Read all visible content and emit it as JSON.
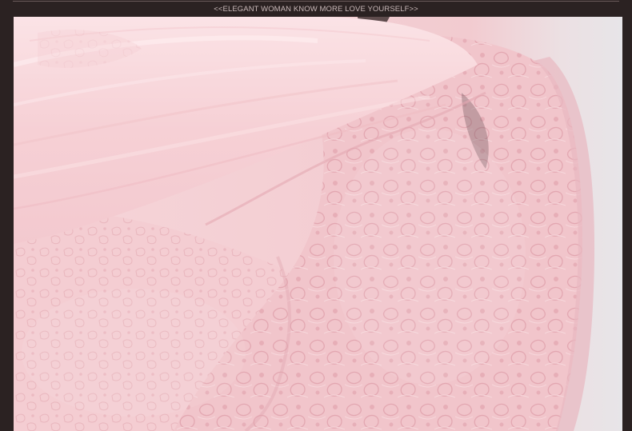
{
  "header": {
    "tagline": "<<ELEGANT WOMAN KNOW MORE LOVE YOURSELF>>"
  },
  "photo": {
    "subject": "pink-chiffon-and-lace-garment-closeup",
    "colors": {
      "background": "#2b2222",
      "chiffon": "#f7d6da",
      "lace": "#f0c3c9",
      "lace_shadow": "#d99aa5",
      "backdrop": "#e9e4e7"
    }
  }
}
